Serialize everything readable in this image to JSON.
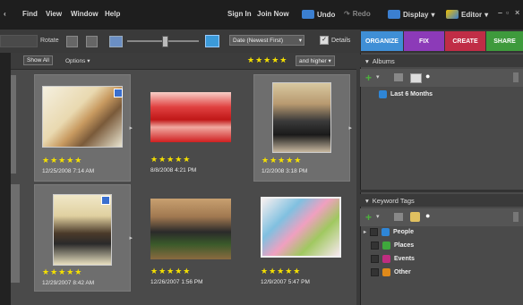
{
  "menubar": {
    "items": [
      "Find",
      "View",
      "Window",
      "Help"
    ],
    "sign_in": "Sign In",
    "join_now": "Join Now",
    "undo": "Undo",
    "redo": "Redo",
    "display": "Display",
    "editor": "Editor"
  },
  "toolbar": {
    "rotate_label": "Rotate",
    "sort_value": "Date (Newest First)",
    "details_label": "Details"
  },
  "tabs": [
    {
      "label": "ORGANIZE",
      "color": "#3f8fd6"
    },
    {
      "label": "FIX",
      "color": "#8c3ab8"
    },
    {
      "label": "CREATE",
      "color": "#c02d46"
    },
    {
      "label": "SHARE",
      "color": "#3e9a3c"
    }
  ],
  "grid_header": {
    "show_all": "Show All",
    "options": "Options",
    "rating_filter": "and higher"
  },
  "photos": [
    {
      "stars": "★★★★★",
      "date": "12/25/2008 7:14 AM"
    },
    {
      "stars": "★★★★★",
      "date": "8/8/2008 4:21 PM"
    },
    {
      "stars": "★★★★★",
      "date": "1/2/2008 3:18 PM"
    },
    {
      "stars": "★★★★★",
      "date": "12/29/2007 8:42 AM"
    },
    {
      "stars": "★★★★★",
      "date": "12/26/2007 1:56 PM"
    },
    {
      "stars": "★★★★★",
      "date": "12/9/2007 5:47 PM"
    }
  ],
  "albums": {
    "title": "Albums",
    "items": [
      "Last 6 Months"
    ]
  },
  "keyword_tags": {
    "title": "Keyword Tags",
    "items": [
      {
        "label": "People",
        "color": "#2f86d6"
      },
      {
        "label": "Places",
        "color": "#3fa83c"
      },
      {
        "label": "Events",
        "color": "#c02d80"
      },
      {
        "label": "Other",
        "color": "#e08a1a"
      }
    ]
  }
}
